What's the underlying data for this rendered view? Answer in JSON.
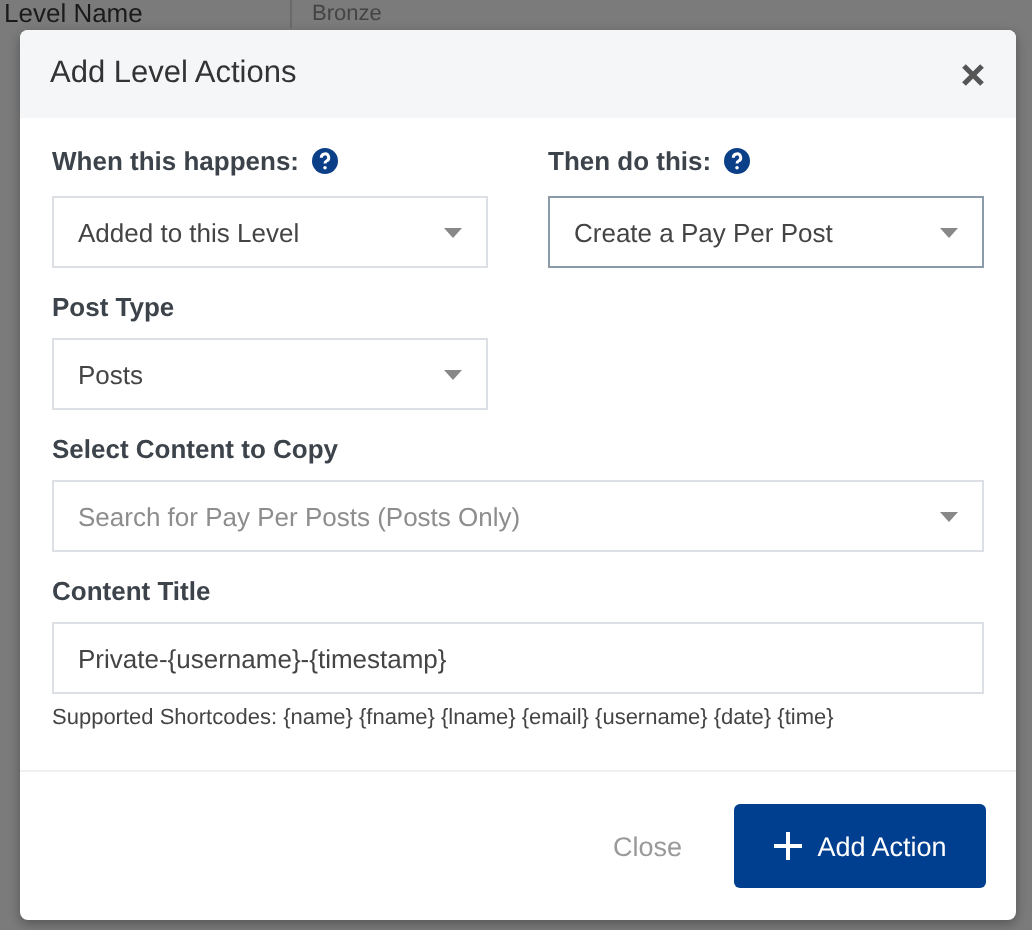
{
  "background": {
    "heading": "Level Name",
    "field_value": "Bronze"
  },
  "dialog": {
    "title": "Add Level Actions"
  },
  "rows": [
    [
      {
        "kind": "select",
        "label": "When this happens:",
        "help": true,
        "value": "Added to this Level",
        "focused": false
      },
      {
        "kind": "select",
        "label": "Then do this:",
        "help": true,
        "value": "Create a Pay Per Post",
        "focused": true
      }
    ],
    [
      {
        "kind": "select",
        "label": "Post Type",
        "help": false,
        "value": "Posts",
        "focused": false
      }
    ],
    [
      {
        "kind": "select",
        "label": "Select Content to Copy",
        "help": false,
        "placeholder": "Search for Pay Per Posts (Posts Only)",
        "focused": false
      }
    ],
    [
      {
        "kind": "text",
        "label": "Content Title",
        "help": false,
        "value": "Private-{username}-{timestamp}",
        "focused": false,
        "hint": "Supported Shortcodes: {name} {fname} {lname} {email} {username} {date} {time}"
      }
    ]
  ],
  "buttons": [
    {
      "kind": "link",
      "label": "Close"
    },
    {
      "kind": "primary",
      "label": "Add Action"
    }
  ]
}
